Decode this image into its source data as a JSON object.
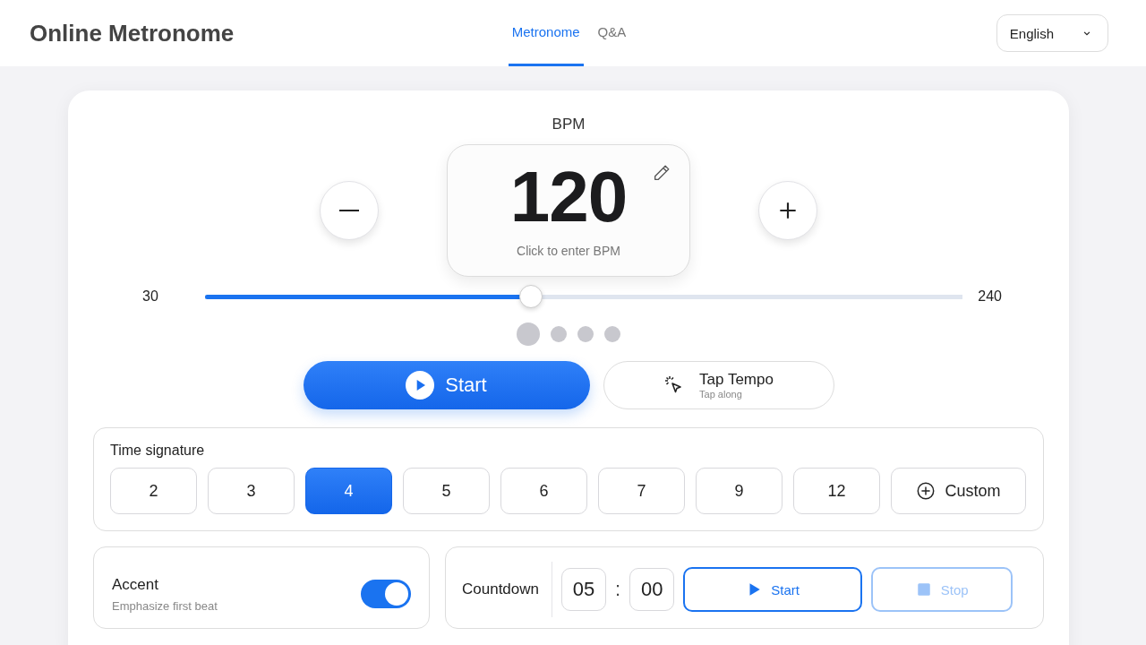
{
  "header": {
    "title": "Online Metronome",
    "tabs": [
      {
        "label": "Metronome",
        "selected": true
      },
      {
        "label": "Q&A",
        "selected": false
      }
    ],
    "language": "English"
  },
  "tempo": {
    "label": "BPM",
    "value": "120",
    "hint": "Click to enter BPM",
    "min": "30",
    "max": "240",
    "level": 0.43,
    "beats": [
      {
        "kind": "accent"
      },
      {
        "kind": "beat"
      },
      {
        "kind": "beat"
      },
      {
        "kind": "beat"
      }
    ],
    "start": "Start",
    "tap": {
      "label": "Tap Tempo",
      "sublabel": "Tap along"
    }
  },
  "time_signature": {
    "title": "Time signature",
    "options": [
      {
        "label": "2",
        "selected": false
      },
      {
        "label": "3",
        "selected": false
      },
      {
        "label": "4",
        "selected": true
      },
      {
        "label": "5",
        "selected": false
      },
      {
        "label": "6",
        "selected": false
      },
      {
        "label": "7",
        "selected": false
      },
      {
        "label": "9",
        "selected": false
      },
      {
        "label": "12",
        "selected": false
      }
    ],
    "custom": "Custom"
  },
  "accent": {
    "title": "Accent",
    "description": "Emphasize first beat",
    "on": true
  },
  "countdown": {
    "label": "Countdown",
    "minutes": "05",
    "separator": ":",
    "seconds": "00",
    "start": {
      "label": "Start",
      "disabled": false
    },
    "stop": {
      "label": "Stop",
      "disabled": true
    }
  }
}
